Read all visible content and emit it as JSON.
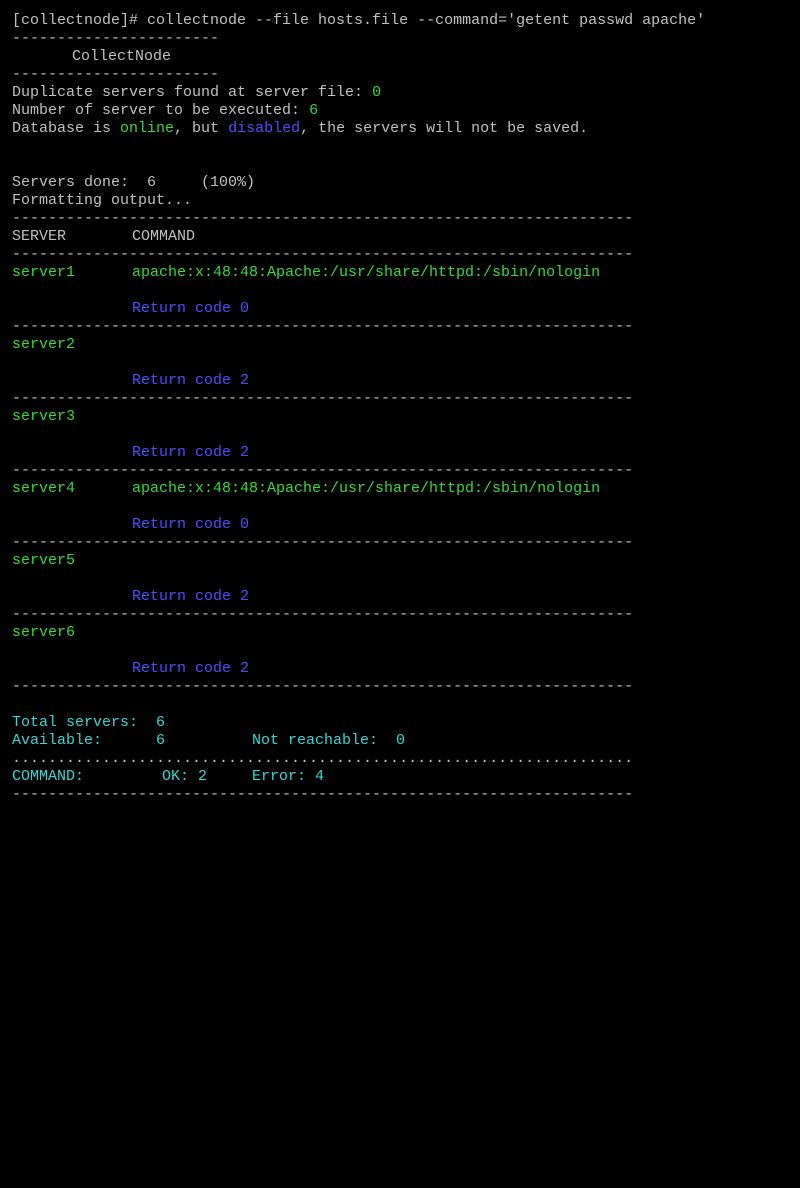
{
  "prompt": "[collectnode]# collectnode --file hosts.file --command='getent passwd apache'",
  "banner": {
    "rule": "-----------------------",
    "title": "CollectNode"
  },
  "summary": {
    "duplicates_label": "Duplicate servers found at server file: ",
    "duplicates_value": "0",
    "executed_label": "Number of server to be executed: ",
    "executed_value": "6",
    "db_prefix": "Database is ",
    "db_online": "online",
    "db_mid": ", but ",
    "db_disabled": "disabled",
    "db_suffix": ", the servers will not be saved."
  },
  "progress": {
    "servers_done": "Servers done:  6     (100%)",
    "formatting": "Formatting output..."
  },
  "table": {
    "rule": "---------------------------------------------------------------------",
    "dot_rule": ".....................................................................",
    "header_server": "SERVER",
    "header_command": "COMMAND",
    "rows": [
      {
        "server": "server1",
        "output": "apache:x:48:48:Apache:/usr/share/httpd:/sbin/nologin",
        "return": "Return code 0"
      },
      {
        "server": "server2",
        "output": "",
        "return": "Return code 2"
      },
      {
        "server": "server3",
        "output": "",
        "return": "Return code 2"
      },
      {
        "server": "server4",
        "output": "apache:x:48:48:Apache:/usr/share/httpd:/sbin/nologin",
        "return": "Return code 0"
      },
      {
        "server": "server5",
        "output": "",
        "return": "Return code 2"
      },
      {
        "server": "server6",
        "output": "",
        "return": "Return code 2"
      }
    ]
  },
  "totals": {
    "total_label": "Total servers:  ",
    "total_value": "6",
    "available_label": "Available:      ",
    "available_value": "6",
    "unreachable_label": "Not reachable:  ",
    "unreachable_value": "0",
    "command_label": "COMMAND:",
    "ok_label": "OK: 2",
    "error_label": "Error: 4"
  },
  "colors": {
    "background": "#000000",
    "text": "#c0c0c0",
    "green": "#3cd83c",
    "blue": "#4d4dff",
    "cyan": "#3ad6d6"
  }
}
